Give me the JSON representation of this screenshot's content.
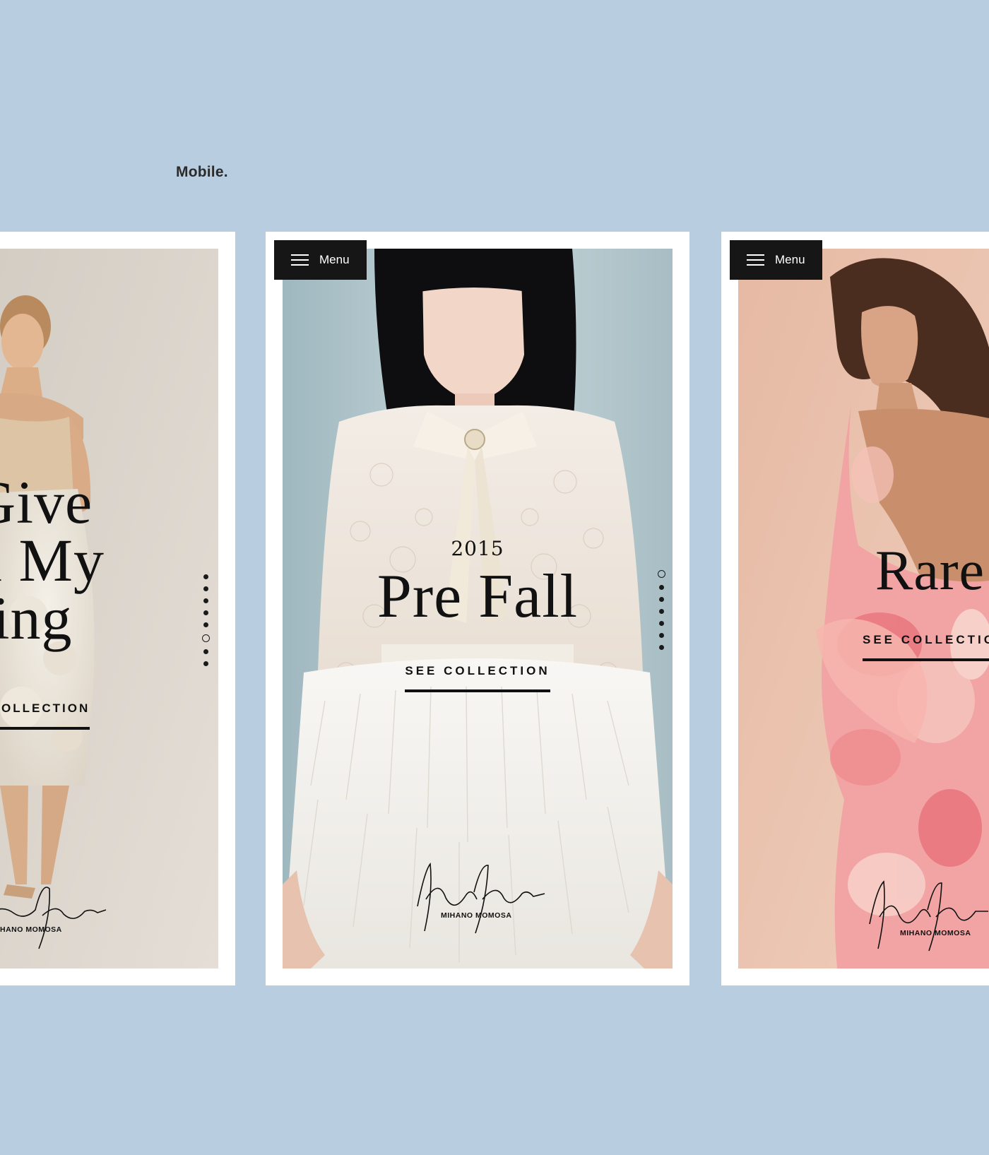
{
  "section_label": "Mobile.",
  "colors": {
    "background": "#b9cde0",
    "card": "#ffffff",
    "menu_bar": "#161616"
  },
  "cards": {
    "left": {
      "title_lines": [
        "Give",
        "u My",
        "ring"
      ],
      "cta": "OLLECTION",
      "brand": "HANO MOMOSA",
      "active_dot": 6,
      "dot_count": 9
    },
    "center": {
      "menu_label": "Menu",
      "year": "2015",
      "title": "Pre Fall",
      "cta": "SEE COLLECTION",
      "brand": "MIHANO MOMOSA",
      "active_dot": 1,
      "dot_count": 9
    },
    "right": {
      "menu_label": "Menu",
      "title": "Rare",
      "cta": "SEE COLLECTIO",
      "brand": "MIHANO MOMOSA"
    }
  }
}
